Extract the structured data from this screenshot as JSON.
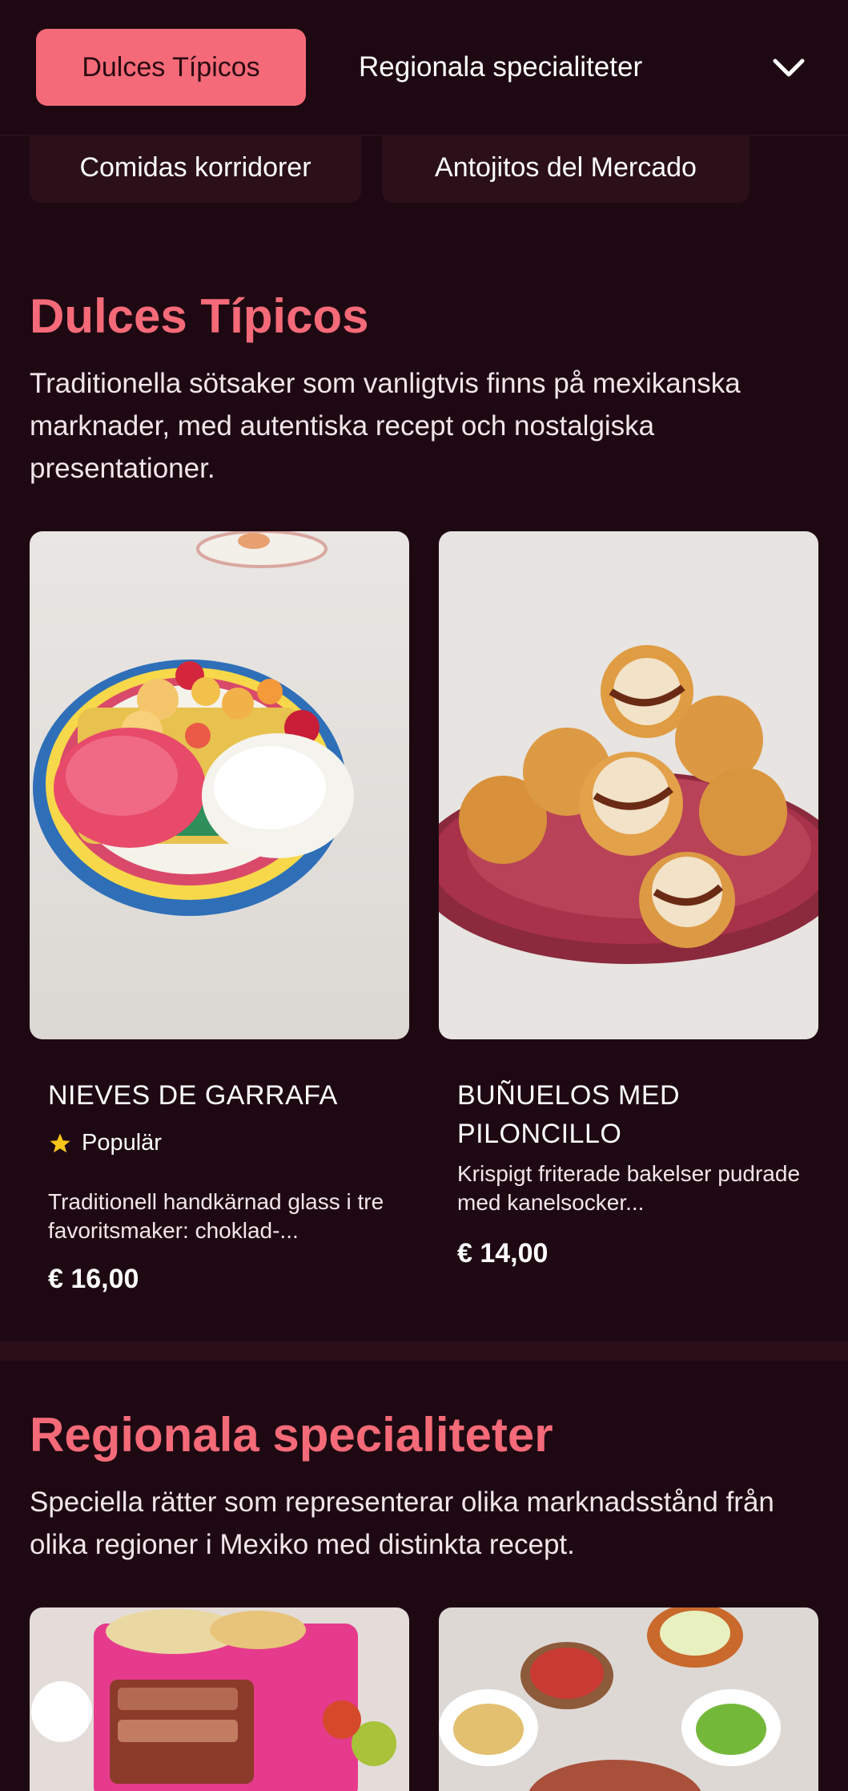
{
  "topbar": {
    "tab_active": "Dulces Típicos",
    "tab_2": "Regionala specialiteter",
    "subtabs": [
      "Comidas korridorer",
      "Antojitos del Mercado"
    ]
  },
  "sections": [
    {
      "title": "Dulces Típicos",
      "description": "Traditionella sötsaker som vanligtvis finns på mexikanska marknader, med autentiska recept och nostalgiska presentationer.",
      "items": [
        {
          "name": "NIEVES DE GARRAFA",
          "badge": "Populär",
          "description": "Traditionell handkärnad glass i tre favoritsmaker: choklad-...",
          "price": "€ 16,00"
        },
        {
          "name": "BUÑUELOS MED PILONCILLO",
          "description": "Krispigt friterade bakelser pudrade med kanelsocker...",
          "price": "€ 14,00"
        }
      ]
    },
    {
      "title": "Regionala specialiteter",
      "description": "Speciella rätter som representerar olika marknadsstånd från olika regioner i Mexiko med distinkta recept."
    }
  ],
  "colors": {
    "background": "#1e0912",
    "accent": "#f56a78",
    "chip": "#2b1019"
  },
  "icons": [
    "chevron-down-icon",
    "star-icon"
  ]
}
